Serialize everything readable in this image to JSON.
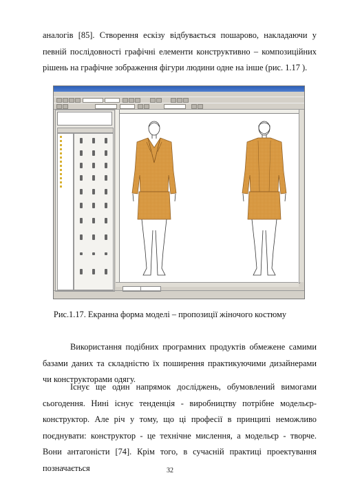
{
  "intro_text": "аналогів [85]. Створення ескізу відбувається пошарово, накладаючи у певній послідовності графічні елементи конструктивно – композиційних рішень на графічне зображення фігури людини одне на інше (рис. 1.17 ).",
  "caption": "Рис.1.17. Екранна форма моделі – пропозиції жіночого костюму",
  "paragraph_2": "Використання подібних програмних продуктів обмежене самими базами даних та складністю їх поширення практикуючими дизайнерами чи конструкторами одягу.",
  "paragraph_3": "Існує ще один напрямок досліджень, обумовлений вимогами сьогодення. Нині існує тенденція - виробництву потрібне модельєр-конструктор. Але річ у тому, що ці професії в принципі неможливо поєднувати: конструктор - це технічне мислення, а модельєр - творче. Вони антагоністи [74]. Крім того, в сучасній практиці проектування позначається",
  "page_number": "32",
  "colors": {
    "suit": "#d4923a",
    "suit_dark": "#8a5a20"
  }
}
